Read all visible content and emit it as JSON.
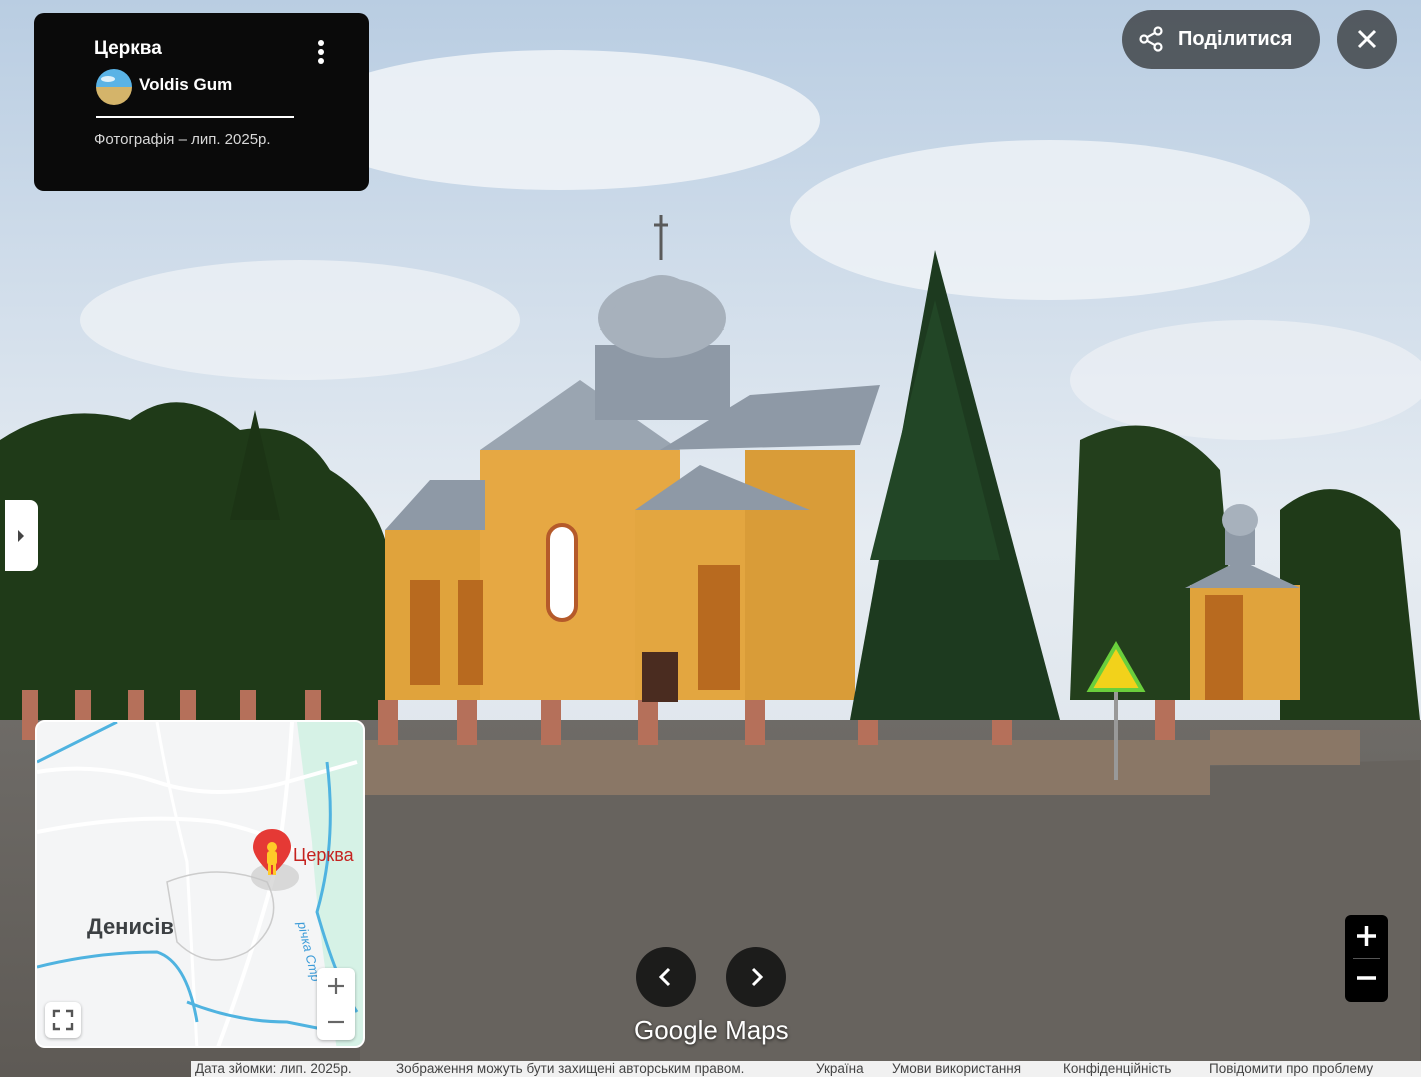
{
  "info_card": {
    "title": "Церква",
    "author": "Voldis Gum",
    "photo_date": "Фотографія – лип. 2025р."
  },
  "toolbar": {
    "share_label": "Поділитися"
  },
  "minimap": {
    "place_label": "Денисів",
    "poi_label": "Церква",
    "river_label": "річка Стр"
  },
  "brand": "Google Maps",
  "footer": {
    "capture_date": "Дата зйомки: лип. 2025р.",
    "copyright": "Зображення можуть бути захищені авторським правом.",
    "country": "Україна",
    "terms": "Умови використання",
    "privacy": "Конфіденційність",
    "report": "Повідомити про проблему"
  },
  "icons": {
    "share": "share-icon",
    "close": "close-icon",
    "more": "more-vert-icon",
    "expand": "chevron-right-icon",
    "prev": "chevron-left-icon",
    "next": "chevron-right-icon",
    "zoom_in": "plus-icon",
    "zoom_out": "minus-icon",
    "fullscreen": "fullscreen-icon",
    "pegman": "pegman-icon"
  },
  "colors": {
    "church_wall": "#e0a33c",
    "roof": "#8e99a6",
    "poi_red": "#c5221f",
    "river": "#4fb3e0"
  }
}
